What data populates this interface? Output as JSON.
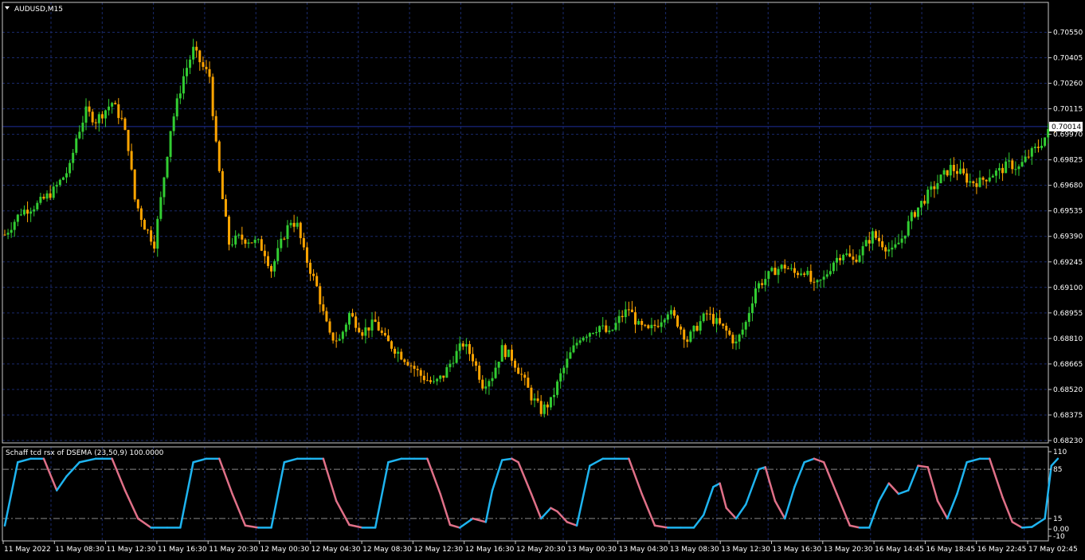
{
  "window": {
    "symbol_title": "AUDUSD,M15",
    "indicator_title": "Schaff tcd rsx of DSEMA (23,50,9) 100.0000"
  },
  "colors": {
    "background": "#000000",
    "grid": "#1a2a6c",
    "frame": "#c8c8c8",
    "bull": "#32cd32",
    "bear": "#ffa500",
    "price_line": "#1e2f9c",
    "indicator_up": "#1eb4f0",
    "indicator_down": "#e07088",
    "level_line": "#8a8a8a",
    "text": "#ffffff",
    "price_label_bg": "#ffffff",
    "price_label_text": "#000000"
  },
  "chart_data": [
    {
      "type": "candlestick",
      "title": "AUDUSD,M15",
      "ylim": [
        0.6823,
        0.7062
      ],
      "y_ticks": [
        "0.70550",
        "0.70405",
        "0.70260",
        "0.70115",
        "0.69970",
        "0.69825",
        "0.69680",
        "0.69535",
        "0.69390",
        "0.69245",
        "0.69100",
        "0.68955",
        "0.68810",
        "0.68665",
        "0.68520",
        "0.68375",
        "0.68230"
      ],
      "current_price": "0.70014",
      "x_ticks": [
        "11 May 2022",
        "11 May 08:30",
        "11 May 12:30",
        "11 May 16:30",
        "11 May 20:30",
        "12 May 00:30",
        "12 May 04:30",
        "12 May 08:30",
        "12 May 12:30",
        "12 May 16:30",
        "12 May 20:30",
        "13 May 00:30",
        "13 May 04:30",
        "13 May 08:30",
        "13 May 12:30",
        "13 May 16:30",
        "13 May 20:30",
        "16 May 14:45",
        "16 May 18:45",
        "16 May 22:45",
        "17 May 02:45"
      ],
      "close_path": [
        [
          0,
          0.694
        ],
        [
          5,
          0.6953
        ],
        [
          10,
          0.6957
        ],
        [
          15,
          0.6965
        ],
        [
          20,
          0.6978
        ],
        [
          22,
          0.6995
        ],
        [
          25,
          0.701
        ],
        [
          28,
          0.7005
        ],
        [
          33,
          0.7015
        ],
        [
          36,
          0.7005
        ],
        [
          38,
          0.699
        ],
        [
          40,
          0.696
        ],
        [
          43,
          0.6945
        ],
        [
          46,
          0.6935
        ],
        [
          48,
          0.696
        ],
        [
          51,
          0.7
        ],
        [
          55,
          0.703
        ],
        [
          58,
          0.7045
        ],
        [
          61,
          0.7035
        ],
        [
          63,
          0.703
        ],
        [
          65,
          0.699
        ],
        [
          67,
          0.696
        ],
        [
          69,
          0.6935
        ],
        [
          72,
          0.6938
        ],
        [
          75,
          0.6937
        ],
        [
          78,
          0.6935
        ],
        [
          80,
          0.693
        ],
        [
          82,
          0.692
        ],
        [
          84,
          0.693
        ],
        [
          86,
          0.694
        ],
        [
          88,
          0.6948
        ],
        [
          90,
          0.6945
        ],
        [
          92,
          0.693
        ],
        [
          94,
          0.692
        ],
        [
          96,
          0.691
        ],
        [
          98,
          0.6895
        ],
        [
          100,
          0.6882
        ],
        [
          103,
          0.688
        ],
        [
          106,
          0.6895
        ],
        [
          110,
          0.6885
        ],
        [
          114,
          0.689
        ],
        [
          117,
          0.688
        ],
        [
          120,
          0.6875
        ],
        [
          124,
          0.6868
        ],
        [
          128,
          0.686
        ],
        [
          132,
          0.6855
        ],
        [
          135,
          0.686
        ],
        [
          138,
          0.687
        ],
        [
          141,
          0.6878
        ],
        [
          144,
          0.687
        ],
        [
          147,
          0.6855
        ],
        [
          150,
          0.686
        ],
        [
          153,
          0.6875
        ],
        [
          156,
          0.687
        ],
        [
          159,
          0.686
        ],
        [
          162,
          0.6848
        ],
        [
          165,
          0.684
        ],
        [
          168,
          0.6845
        ],
        [
          171,
          0.686
        ],
        [
          174,
          0.6872
        ],
        [
          177,
          0.6882
        ],
        [
          180,
          0.6885
        ],
        [
          183,
          0.6888
        ],
        [
          186,
          0.6883
        ],
        [
          189,
          0.6892
        ],
        [
          192,
          0.6898
        ],
        [
          195,
          0.6888
        ],
        [
          198,
          0.6885
        ],
        [
          201,
          0.689
        ],
        [
          204,
          0.6897
        ],
        [
          207,
          0.689
        ],
        [
          210,
          0.688
        ],
        [
          213,
          0.6888
        ],
        [
          216,
          0.6895
        ],
        [
          219,
          0.689
        ],
        [
          222,
          0.6885
        ],
        [
          225,
          0.6878
        ],
        [
          228,
          0.689
        ],
        [
          231,
          0.691
        ],
        [
          234,
          0.6915
        ],
        [
          237,
          0.692
        ],
        [
          240,
          0.6922
        ],
        [
          243,
          0.6918
        ],
        [
          246,
          0.692
        ],
        [
          249,
          0.691
        ],
        [
          252,
          0.6915
        ],
        [
          255,
          0.6925
        ],
        [
          258,
          0.693
        ],
        [
          261,
          0.6925
        ],
        [
          264,
          0.6932
        ],
        [
          267,
          0.694
        ],
        [
          270,
          0.6935
        ],
        [
          273,
          0.693
        ],
        [
          276,
          0.6938
        ],
        [
          279,
          0.695
        ],
        [
          282,
          0.6958
        ],
        [
          285,
          0.6965
        ],
        [
          288,
          0.6972
        ],
        [
          291,
          0.6978
        ],
        [
          294,
          0.6975
        ],
        [
          297,
          0.697
        ],
        [
          300,
          0.697
        ],
        [
          303,
          0.6974
        ],
        [
          306,
          0.6976
        ],
        [
          309,
          0.698
        ],
        [
          312,
          0.6978
        ],
        [
          315,
          0.6985
        ],
        [
          318,
          0.699
        ],
        [
          321,
          0.6998
        ],
        [
          323,
          0.7001
        ]
      ]
    },
    {
      "type": "line",
      "title": "Schaff tcd rsx of DSEMA (23,50,9) 100.0000",
      "ylim": [
        -10,
        110
      ],
      "y_ticks": [
        "110",
        "85",
        "15",
        "0.00",
        "-10"
      ],
      "levels": [
        85,
        15
      ],
      "series": [
        {
          "points": [
            [
              0,
              5
            ],
            [
              4,
              95
            ],
            [
              8,
              100
            ],
            [
              12,
              100
            ],
            [
              16,
              55
            ],
            [
              19,
              75
            ],
            [
              23,
              95
            ],
            [
              28,
              100
            ],
            [
              33,
              100
            ],
            [
              37,
              55
            ],
            [
              41,
              15
            ],
            [
              45,
              2
            ],
            [
              50,
              2
            ],
            [
              54,
              2
            ],
            [
              58,
              95
            ],
            [
              62,
              100
            ],
            [
              66,
              100
            ],
            [
              70,
              50
            ],
            [
              74,
              5
            ],
            [
              78,
              2
            ],
            [
              82,
              2
            ],
            [
              86,
              95
            ],
            [
              90,
              100
            ],
            [
              94,
              100
            ],
            [
              98,
              100
            ],
            [
              102,
              40
            ],
            [
              106,
              6
            ],
            [
              110,
              2
            ],
            [
              114,
              2
            ],
            [
              118,
              95
            ],
            [
              122,
              100
            ],
            [
              126,
              100
            ],
            [
              130,
              100
            ],
            [
              134,
              50
            ],
            [
              137,
              6
            ],
            [
              140,
              2
            ],
            [
              144,
              15
            ],
            [
              148,
              10
            ],
            [
              150,
              55
            ],
            [
              153,
              98
            ],
            [
              156,
              100
            ],
            [
              158,
              95
            ],
            [
              162,
              50
            ],
            [
              165,
              15
            ],
            [
              168,
              30
            ],
            [
              170,
              25
            ],
            [
              173,
              10
            ],
            [
              176,
              5
            ],
            [
              180,
              90
            ],
            [
              184,
              100
            ],
            [
              188,
              100
            ],
            [
              192,
              100
            ],
            [
              196,
              50
            ],
            [
              200,
              5
            ],
            [
              204,
              2
            ],
            [
              208,
              2
            ],
            [
              212,
              2
            ],
            [
              215,
              20
            ],
            [
              218,
              60
            ],
            [
              220,
              65
            ],
            [
              222,
              30
            ],
            [
              225,
              15
            ],
            [
              228,
              35
            ],
            [
              232,
              85
            ],
            [
              234,
              88
            ],
            [
              237,
              40
            ],
            [
              240,
              15
            ],
            [
              243,
              60
            ],
            [
              246,
              95
            ],
            [
              249,
              100
            ],
            [
              252,
              95
            ],
            [
              256,
              50
            ],
            [
              260,
              5
            ],
            [
              263,
              2
            ],
            [
              266,
              2
            ],
            [
              269,
              40
            ],
            [
              272,
              65
            ],
            [
              275,
              50
            ],
            [
              278,
              55
            ],
            [
              281,
              90
            ],
            [
              284,
              88
            ],
            [
              287,
              40
            ],
            [
              290,
              15
            ],
            [
              293,
              50
            ],
            [
              296,
              95
            ],
            [
              300,
              100
            ],
            [
              303,
              100
            ],
            [
              307,
              45
            ],
            [
              310,
              10
            ],
            [
              313,
              2
            ],
            [
              316,
              3
            ],
            [
              320,
              15
            ],
            [
              322,
              90
            ],
            [
              324,
              100
            ]
          ]
        }
      ]
    }
  ]
}
